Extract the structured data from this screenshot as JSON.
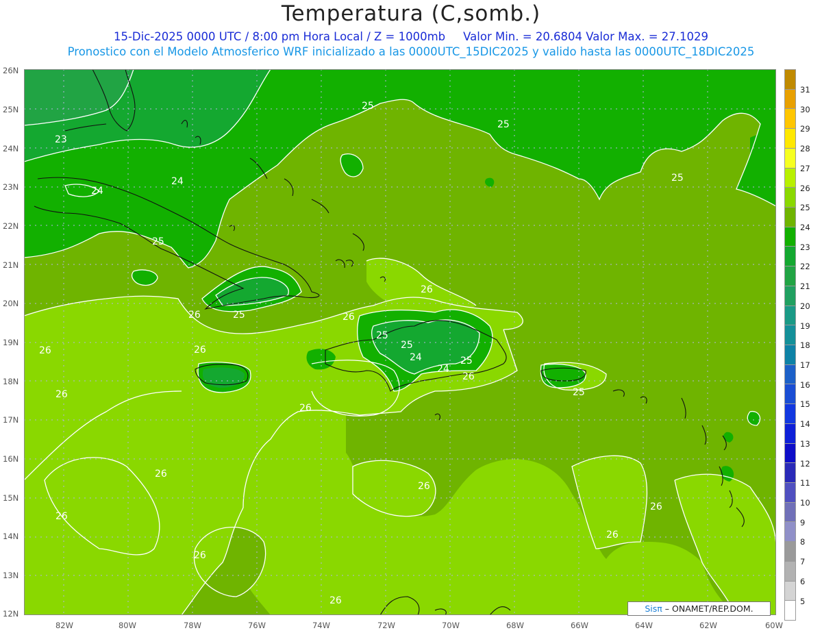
{
  "title": "Temperatura (C,somb.)",
  "subtitle": {
    "datetime": "15-Dic-2025  0000 UTC / 8:00 pm Hora Local / Z = 1000mb",
    "minmax": "Valor Min. = 20.6804  Valor Max. = 27.1029",
    "model_note": "Pronostico con el Modelo Atmosferico WRF inicializado a las 0000UTC_15DIC2025 y valido hasta las  0000UTC_18DIC2025"
  },
  "latitude_labels": [
    "26N",
    "25N",
    "24N",
    "23N",
    "22N",
    "21N",
    "20N",
    "19N",
    "18N",
    "17N",
    "16N",
    "15N",
    "14N",
    "13N",
    "12N"
  ],
  "longitude_labels": [
    "82W",
    "80W",
    "78W",
    "76W",
    "74W",
    "72W",
    "70W",
    "68W",
    "66W",
    "64W",
    "62W",
    "60W"
  ],
  "contour_labels": [
    {
      "text": "23"
    },
    {
      "text": "24"
    },
    {
      "text": "24"
    },
    {
      "text": "25"
    },
    {
      "text": "25"
    },
    {
      "text": "25"
    },
    {
      "text": "25"
    },
    {
      "text": "25"
    },
    {
      "text": "25"
    },
    {
      "text": "25"
    },
    {
      "text": "25"
    },
    {
      "text": "25"
    },
    {
      "text": "26"
    },
    {
      "text": "26"
    },
    {
      "text": "26"
    },
    {
      "text": "26"
    },
    {
      "text": "26"
    },
    {
      "text": "26"
    },
    {
      "text": "26"
    },
    {
      "text": "26"
    },
    {
      "text": "26"
    },
    {
      "text": "26"
    },
    {
      "text": "26"
    },
    {
      "text": "26"
    },
    {
      "text": "26"
    },
    {
      "text": "26"
    },
    {
      "text": "24"
    },
    {
      "text": "24"
    }
  ],
  "colorbar": {
    "values": [
      "31",
      "30",
      "29",
      "28",
      "27",
      "26",
      "25",
      "24",
      "23",
      "22",
      "21",
      "20",
      "19",
      "18",
      "17",
      "16",
      "15",
      "14",
      "13",
      "12",
      "11",
      "10",
      "9",
      "8",
      "7",
      "6",
      "5"
    ],
    "colors": [
      "#c08a00",
      "#e8a000",
      "#ffc600",
      "#ffe800",
      "#f6ff20",
      "#b8f000",
      "#8ad800",
      "#6fb400",
      "#12b000",
      "#14a830",
      "#21a444",
      "#20a060",
      "#1a9a86",
      "#149099",
      "#0e82a6",
      "#1c60c8",
      "#1a4ed4",
      "#1238e0",
      "#0e20d8",
      "#0e0ec8",
      "#2a2ab8",
      "#5050c0",
      "#7070b8",
      "#9090c8",
      "#9a9a9a",
      "#b2b2b2",
      "#d4d4d4",
      "#ffffff"
    ]
  },
  "credit": {
    "logo": "Sisπ",
    "text": "– ONAMET/REP.DOM."
  }
}
